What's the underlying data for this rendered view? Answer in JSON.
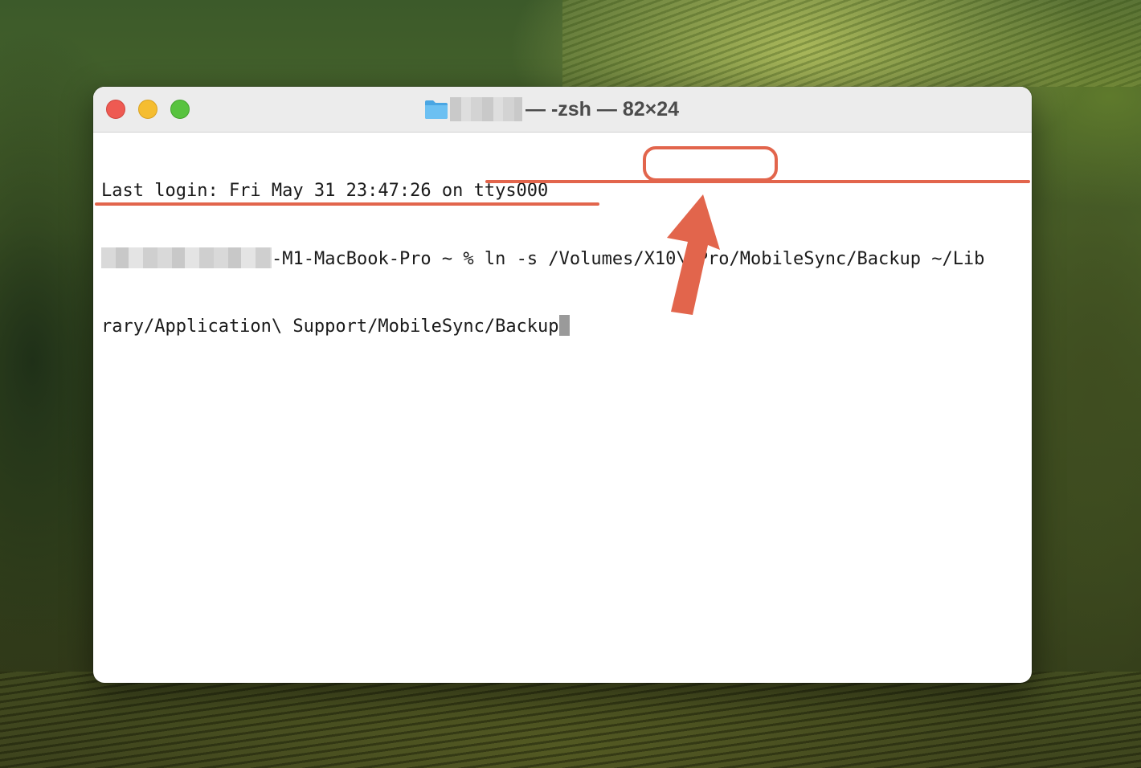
{
  "window": {
    "title_suffix": "— -zsh — 82×24"
  },
  "terminal": {
    "lines": [
      "Last login: Fri May 31 23:47:26 on ttys000",
      "-M1-MacBook-Pro ~ % ln -s /Volumes/X10\\ Pro/MobileSync/Backup ~/Lib",
      "rary/Application\\ Support/MobileSync/Backup"
    ]
  },
  "colors": {
    "annotation": "#e2654c",
    "close": "#ee5a52",
    "minimize": "#f5bd30",
    "zoom": "#58c33f",
    "folder": "#5bb3ea"
  },
  "icons": {
    "folder": "folder-icon",
    "arrow": "up-arrow-annotation"
  }
}
